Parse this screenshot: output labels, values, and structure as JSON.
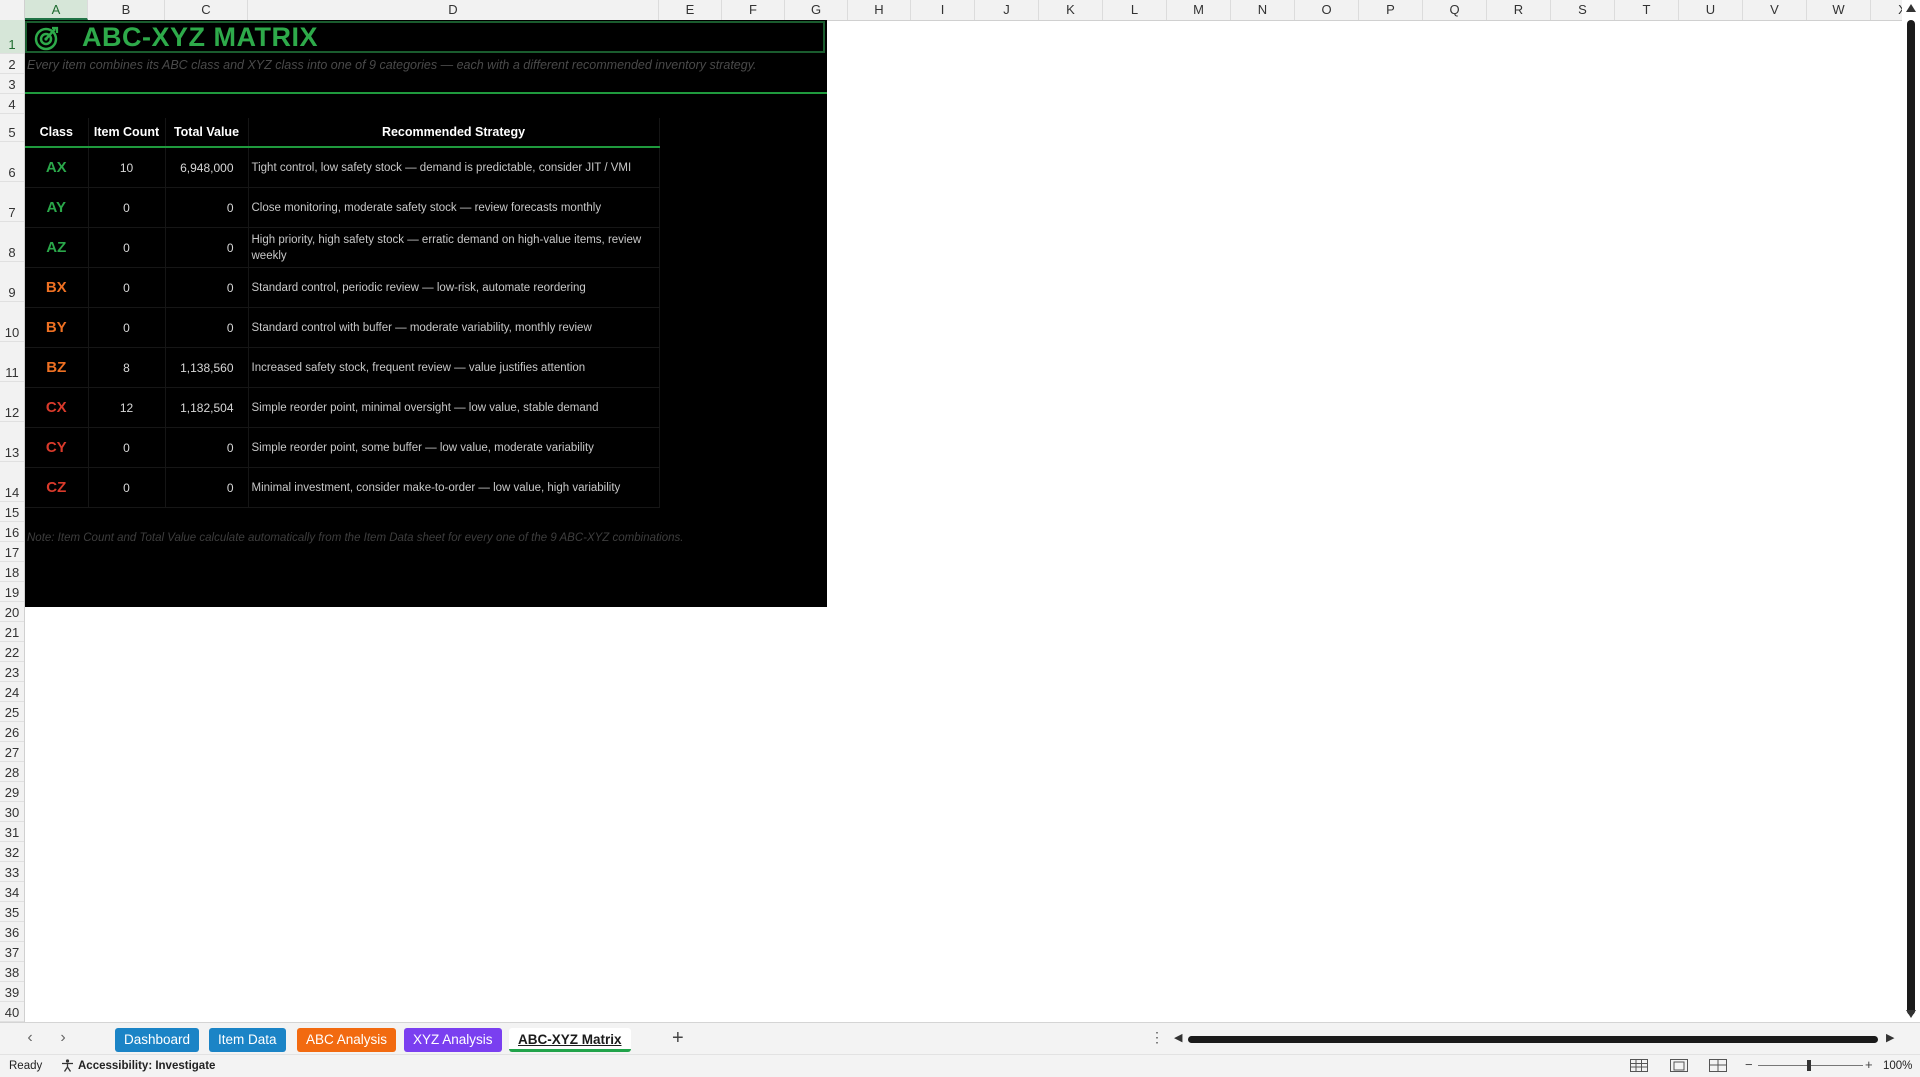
{
  "columns": [
    "A",
    "B",
    "C",
    "D",
    "E",
    "F",
    "G",
    "H",
    "I",
    "J",
    "K",
    "L",
    "M",
    "N",
    "O",
    "P",
    "Q",
    "R",
    "S",
    "T",
    "U",
    "V",
    "W",
    "X"
  ],
  "rows": [
    "1",
    "2",
    "3",
    "4",
    "5",
    "6",
    "7",
    "8",
    "9",
    "10",
    "11",
    "12",
    "13",
    "14",
    "15",
    "16",
    "17",
    "18",
    "19",
    "20",
    "21",
    "22",
    "23",
    "24",
    "25",
    "26",
    "27",
    "28",
    "29",
    "30",
    "31",
    "32",
    "33",
    "34",
    "35",
    "36",
    "37",
    "38",
    "39",
    "40"
  ],
  "sheet": {
    "title": "ABC-XYZ MATRIX",
    "title_icon": "target-icon",
    "subtitle": "Every item combines its ABC class and XYZ class into one of 9 categories — each with a different recommended inventory strategy.",
    "headers": {
      "class": "Class",
      "count": "Item Count",
      "value": "Total Value",
      "strategy": "Recommended Strategy"
    },
    "matrix": [
      {
        "class": "AX",
        "count": "10",
        "value": "6,948,000",
        "strategy": "Tight control, low safety stock — demand is predictable, consider JIT / VMI",
        "color": "#2aa84a"
      },
      {
        "class": "AY",
        "count": "0",
        "value": "0",
        "strategy": "Close monitoring, moderate safety stock — review forecasts monthly",
        "color": "#2aa84a"
      },
      {
        "class": "AZ",
        "count": "0",
        "value": "0",
        "strategy": "High priority, high safety stock — erratic demand on high-value items, review weekly",
        "color": "#2aa84a"
      },
      {
        "class": "BX",
        "count": "0",
        "value": "0",
        "strategy": "Standard control, periodic review — low-risk, automate reordering",
        "color": "#ee7022"
      },
      {
        "class": "BY",
        "count": "0",
        "value": "0",
        "strategy": "Standard control with buffer — moderate variability, monthly review",
        "color": "#ee7022"
      },
      {
        "class": "BZ",
        "count": "8",
        "value": "1,138,560",
        "strategy": "Increased safety stock, frequent review — value justifies attention",
        "color": "#ee7022"
      },
      {
        "class": "CX",
        "count": "12",
        "value": "1,182,504",
        "strategy": "Simple reorder point, minimal oversight — low value, stable demand",
        "color": "#d93a2b"
      },
      {
        "class": "CY",
        "count": "0",
        "value": "0",
        "strategy": "Simple reorder point, some buffer — low value, moderate variability",
        "color": "#d93a2b"
      },
      {
        "class": "CZ",
        "count": "0",
        "value": "0",
        "strategy": "Minimal investment, consider make-to-order — low value, high variability",
        "color": "#d93a2b"
      }
    ],
    "note": "Note: Item Count and Total Value calculate automatically from the Item Data sheet for every one of the 9 ABC-XYZ combinations.",
    "accent_color": "#1f9a3d"
  },
  "tabs": [
    {
      "label": "Dashboard",
      "bg": "#1b84c6",
      "fg": "#ffffff"
    },
    {
      "label": "Item Data",
      "bg": "#1b84c6",
      "fg": "#ffffff"
    },
    {
      "label": "ABC Analysis",
      "bg": "#f26a10",
      "fg": "#ffffff"
    },
    {
      "label": "XYZ Analysis",
      "bg": "#7a3ff0",
      "fg": "#ffffff"
    },
    {
      "label": "ABC-XYZ Matrix",
      "bg": "#ffffff",
      "fg": "#1b1b1b",
      "active": true
    }
  ],
  "status": {
    "ready": "Ready",
    "accessibility": "Accessibility: Investigate",
    "zoom": "100%"
  }
}
